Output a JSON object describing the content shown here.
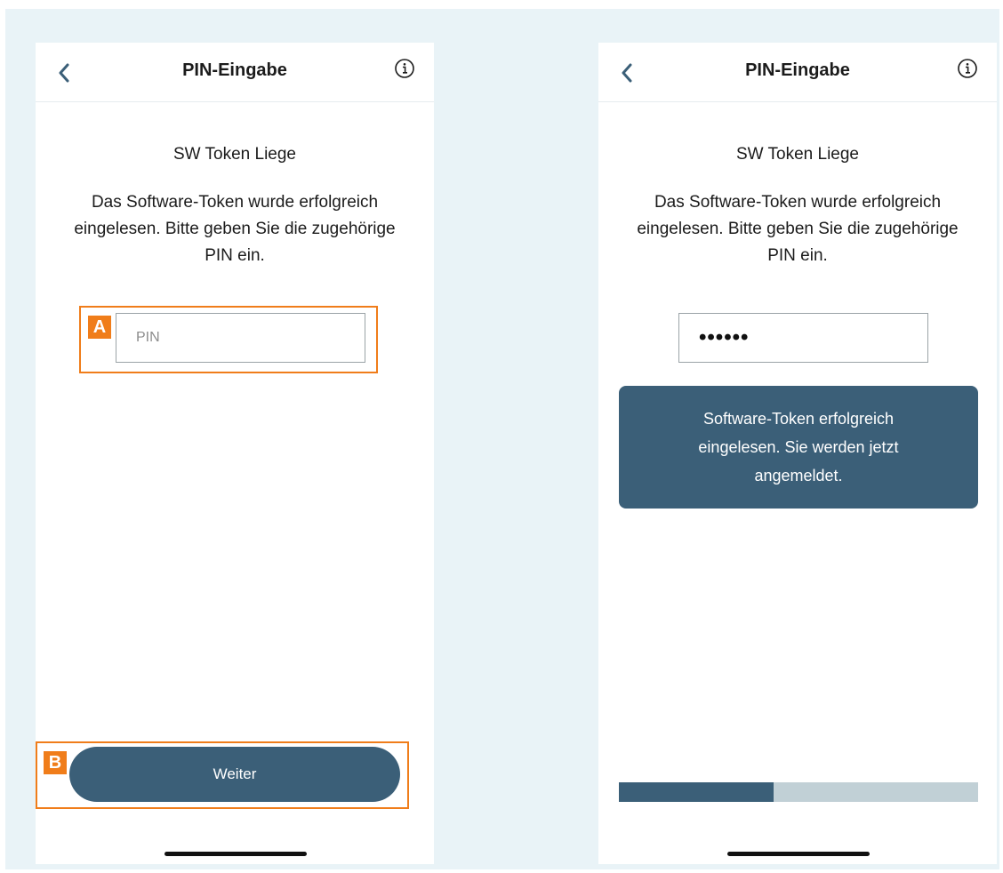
{
  "screens": [
    {
      "header": {
        "title": "PIN-Eingabe",
        "back_icon": "chevron-left-icon",
        "info_icon": "info-icon"
      },
      "token_name": "SW Token Liege",
      "description": "Das Software-Token wurde erfolgreich eingelesen. Bitte geben Sie die zugehörige PIN ein.",
      "pin_input": {
        "placeholder": "PIN",
        "value": ""
      },
      "callouts": {
        "a_label": "A",
        "b_label": "B"
      },
      "continue_button": {
        "label": "Weiter"
      }
    },
    {
      "header": {
        "title": "PIN-Eingabe",
        "back_icon": "chevron-left-icon",
        "info_icon": "info-icon"
      },
      "token_name": "SW Token Liege",
      "description": "Das Software-Token wurde erfolgreich eingelesen. Bitte geben Sie die zugehörige PIN ein.",
      "pin_input": {
        "masked_value": "••••••"
      },
      "toast": {
        "message": "Software-Token erfolgreich eingelesen. Sie werden jetzt angemeldet."
      },
      "progress": {
        "fraction": 0.43
      }
    }
  ],
  "colors": {
    "accent": "#3b5f78",
    "callout": "#f07d1a",
    "background": "#e9f3f7",
    "progress_track": "#c1d0d6"
  }
}
